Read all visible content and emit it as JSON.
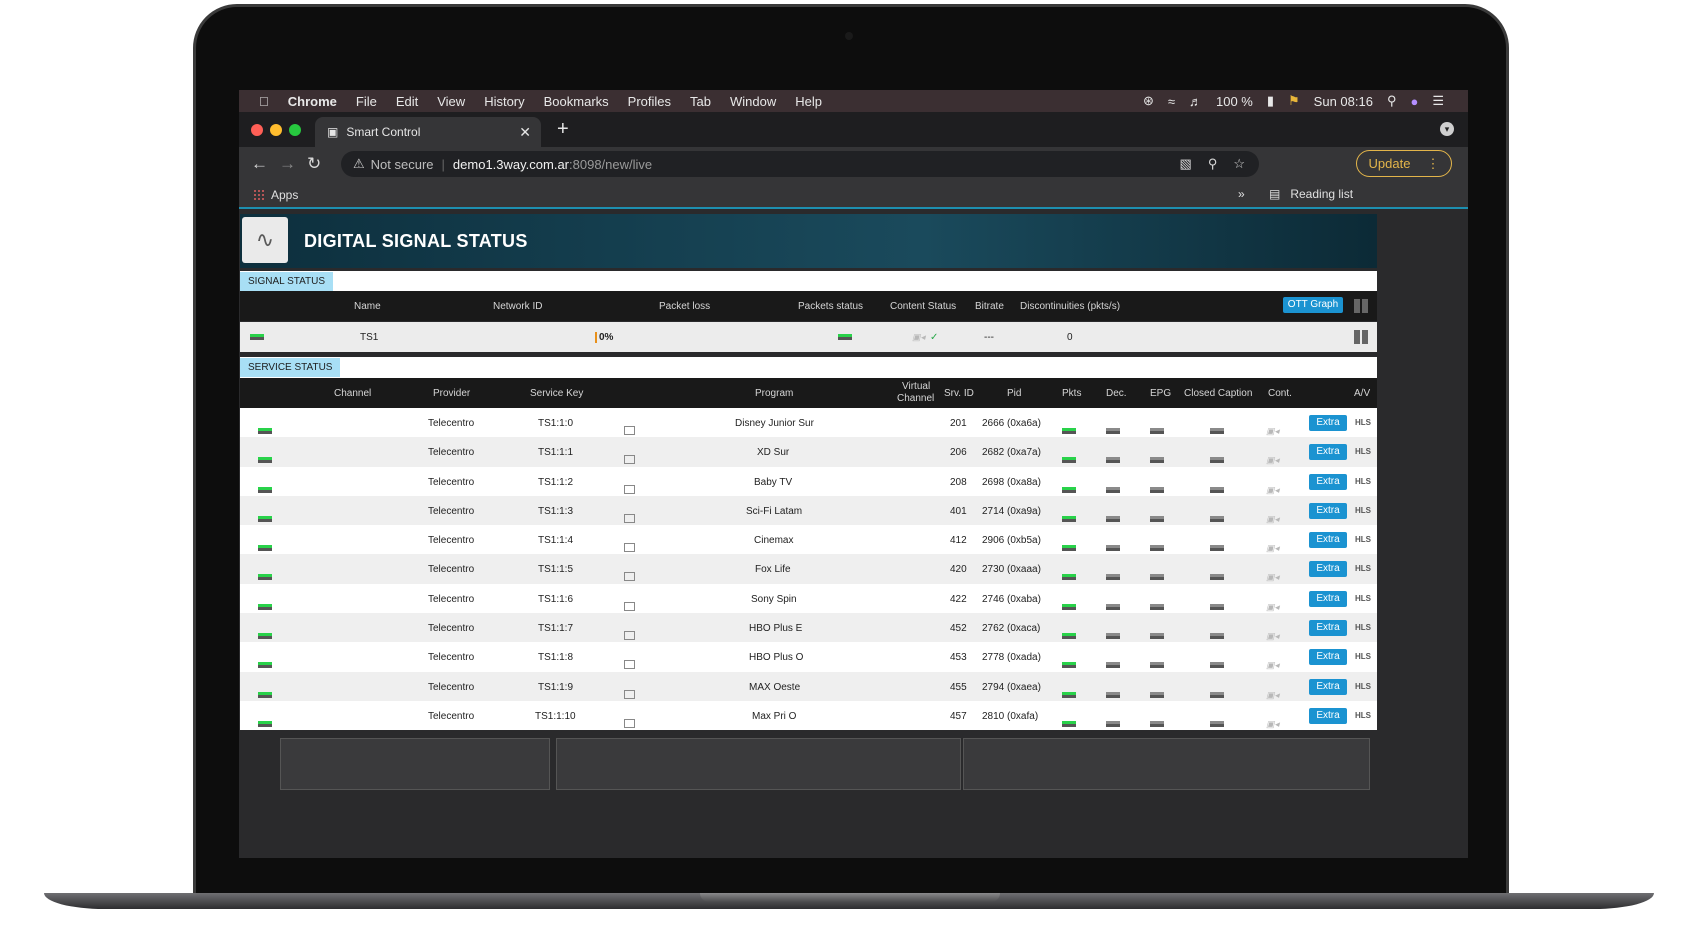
{
  "menubar": {
    "app": "Chrome",
    "items": [
      "File",
      "Edit",
      "View",
      "History",
      "Bookmarks",
      "Profiles",
      "Tab",
      "Window",
      "Help"
    ],
    "battery": "100 %",
    "clock": "Sun 08:16"
  },
  "browser": {
    "tab_title": "Smart Control",
    "url_warning": "Not secure",
    "url_host": "demo1.3way.com.ar",
    "url_path": ":8098/new/live",
    "update_label": "Update",
    "bookmarks_apps": "Apps",
    "reading_list": "Reading list"
  },
  "page": {
    "banner_title": "DIGITAL SIGNAL STATUS",
    "signal_section": "SIGNAL STATUS",
    "service_section": "SERVICE STATUS",
    "ott_button": "OTT Graph",
    "signal_headers": [
      "Name",
      "Network ID",
      "Packet loss",
      "Packets status",
      "Content Status",
      "Bitrate",
      "Discontinuities (pkts/s)"
    ],
    "signal_row": {
      "name": "TS1",
      "packet_loss": "0%",
      "bitrate": "---",
      "discontinuities": "0"
    },
    "service_headers": {
      "channel": "Channel",
      "provider": "Provider",
      "service_key": "Service Key",
      "program": "Program",
      "virtual_channel_1": "Virtual",
      "virtual_channel_2": "Channel",
      "srv_id": "Srv. ID",
      "pid": "Pid",
      "pkts": "Pkts",
      "dec": "Dec.",
      "epg": "EPG",
      "cc": "Closed Caption",
      "cont": "Cont.",
      "av": "A/V"
    },
    "extra_label": "Extra",
    "hls_label": "HLS",
    "services": [
      {
        "provider": "Telecentro",
        "key": "TS1:1:0",
        "program": "Disney Junior Sur",
        "srv_id": "201",
        "pid": "2666 (0xa6a)"
      },
      {
        "provider": "Telecentro",
        "key": "TS1:1:1",
        "program": "XD Sur",
        "srv_id": "206",
        "pid": "2682 (0xa7a)"
      },
      {
        "provider": "Telecentro",
        "key": "TS1:1:2",
        "program": "Baby TV",
        "srv_id": "208",
        "pid": "2698 (0xa8a)"
      },
      {
        "provider": "Telecentro",
        "key": "TS1:1:3",
        "program": "Sci-Fi Latam",
        "srv_id": "401",
        "pid": "2714 (0xa9a)"
      },
      {
        "provider": "Telecentro",
        "key": "TS1:1:4",
        "program": "Cinemax",
        "srv_id": "412",
        "pid": "2906 (0xb5a)"
      },
      {
        "provider": "Telecentro",
        "key": "TS1:1:5",
        "program": "Fox Life",
        "srv_id": "420",
        "pid": "2730 (0xaaa)"
      },
      {
        "provider": "Telecentro",
        "key": "TS1:1:6",
        "program": "Sony Spin",
        "srv_id": "422",
        "pid": "2746 (0xaba)"
      },
      {
        "provider": "Telecentro",
        "key": "TS1:1:7",
        "program": "HBO Plus E",
        "srv_id": "452",
        "pid": "2762 (0xaca)"
      },
      {
        "provider": "Telecentro",
        "key": "TS1:1:8",
        "program": "HBO Plus O",
        "srv_id": "453",
        "pid": "2778 (0xada)"
      },
      {
        "provider": "Telecentro",
        "key": "TS1:1:9",
        "program": "MAX Oeste",
        "srv_id": "455",
        "pid": "2794 (0xaea)"
      },
      {
        "provider": "Telecentro",
        "key": "TS1:1:10",
        "program": "Max Pri O",
        "srv_id": "457",
        "pid": "2810 (0xafa)"
      }
    ]
  },
  "colors": {
    "accent": "#1b93d1",
    "status_ok": "#29d24a",
    "section_tab": "#a8dff5",
    "update": "#e3b54a"
  }
}
